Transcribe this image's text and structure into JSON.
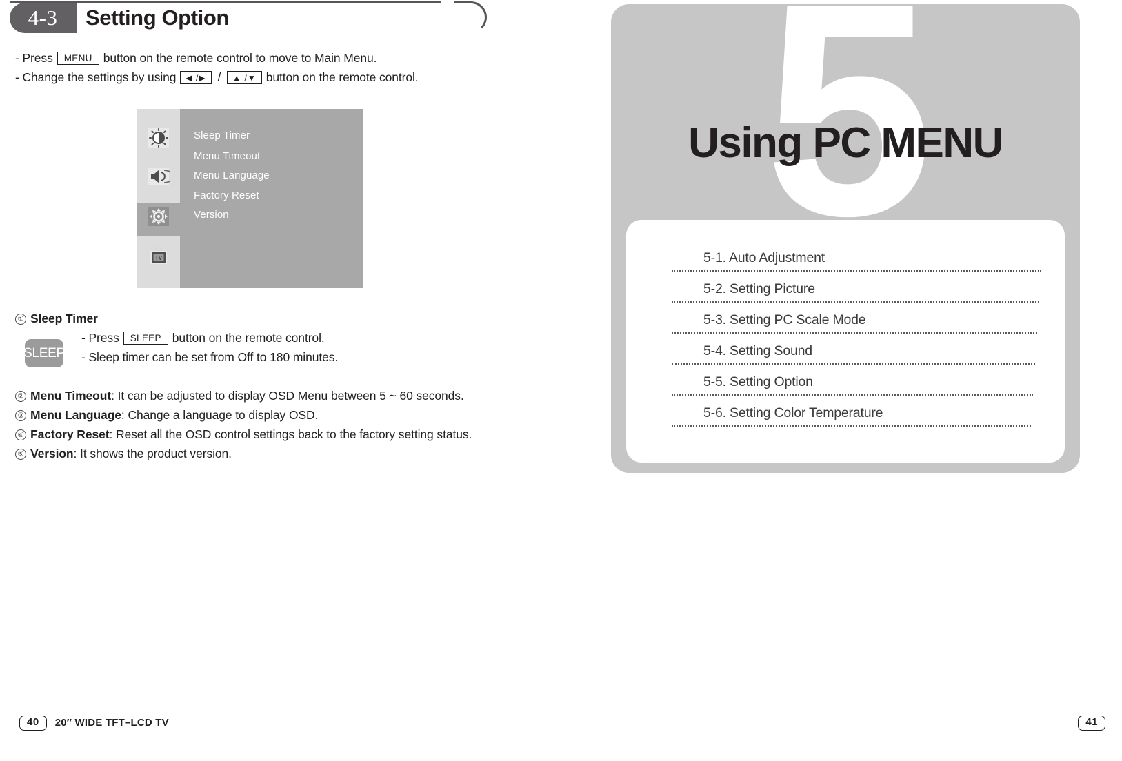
{
  "left_page": {
    "header": {
      "badge": "4-3",
      "title": "Setting Option"
    },
    "intro": {
      "line1_before": "- Press",
      "line1_key": "MENU",
      "line1_after": "button on the remote control to move to Main Menu.",
      "line2_before": "- Change the settings by using",
      "line2_key1": "◀ /▶",
      "line2_sep": "/",
      "line2_key2": "▲ /▼",
      "line2_after": "button on the remote control."
    },
    "osd": {
      "icons": [
        "picture-icon",
        "sound-icon",
        "option-gear-icon",
        "tv-icon"
      ],
      "items": [
        "Sleep Timer",
        "Menu Timeout",
        "Menu Language",
        "Factory Reset",
        "Version"
      ]
    },
    "numbered": [
      {
        "num": "①",
        "term": "Sleep Timer",
        "desc": ""
      },
      {
        "num": "②",
        "term": "Menu Timeout",
        "desc": " : It can be adjusted to display OSD Menu between 5 ~ 60 seconds."
      },
      {
        "num": "③",
        "term": "Menu Language",
        "desc": " : Change a language to display OSD."
      },
      {
        "num": "④",
        "term": "Factory Reset",
        "desc": " : Reset all the OSD control settings back to the factory setting status."
      },
      {
        "num": "⑤",
        "term": "Version",
        "desc": " : It shows the product version."
      }
    ],
    "sleep_block": {
      "key_label": "SLEEP",
      "line1_before": "- Press",
      "line1_key": "SLEEP",
      "line1_after": "button on the remote control.",
      "line2": "- Sleep timer can be set from Off to 180 minutes."
    },
    "footer": {
      "page": "40",
      "label": "20″ WIDE TFT–LCD TV"
    }
  },
  "right_page": {
    "chapter_number": "5",
    "chapter_heading": "Using PC MENU",
    "toc": [
      "5-1. Auto Adjustment",
      "5-2. Setting Picture",
      "5-3. Setting PC Scale Mode",
      "5-4. Setting Sound",
      "5-5. Setting Option",
      "5-6. Setting Color Temperature"
    ],
    "footer": {
      "page": "41"
    }
  },
  "colors": {
    "badge_gray": "#636063",
    "rule_gray": "#5a5558",
    "osd_body": "#a8a8a8",
    "osd_iconcol": "#dcdcdc",
    "panel_gray": "#c6c6c6",
    "sleep_key_gray": "#9b9b9b",
    "text": "#231f20"
  }
}
